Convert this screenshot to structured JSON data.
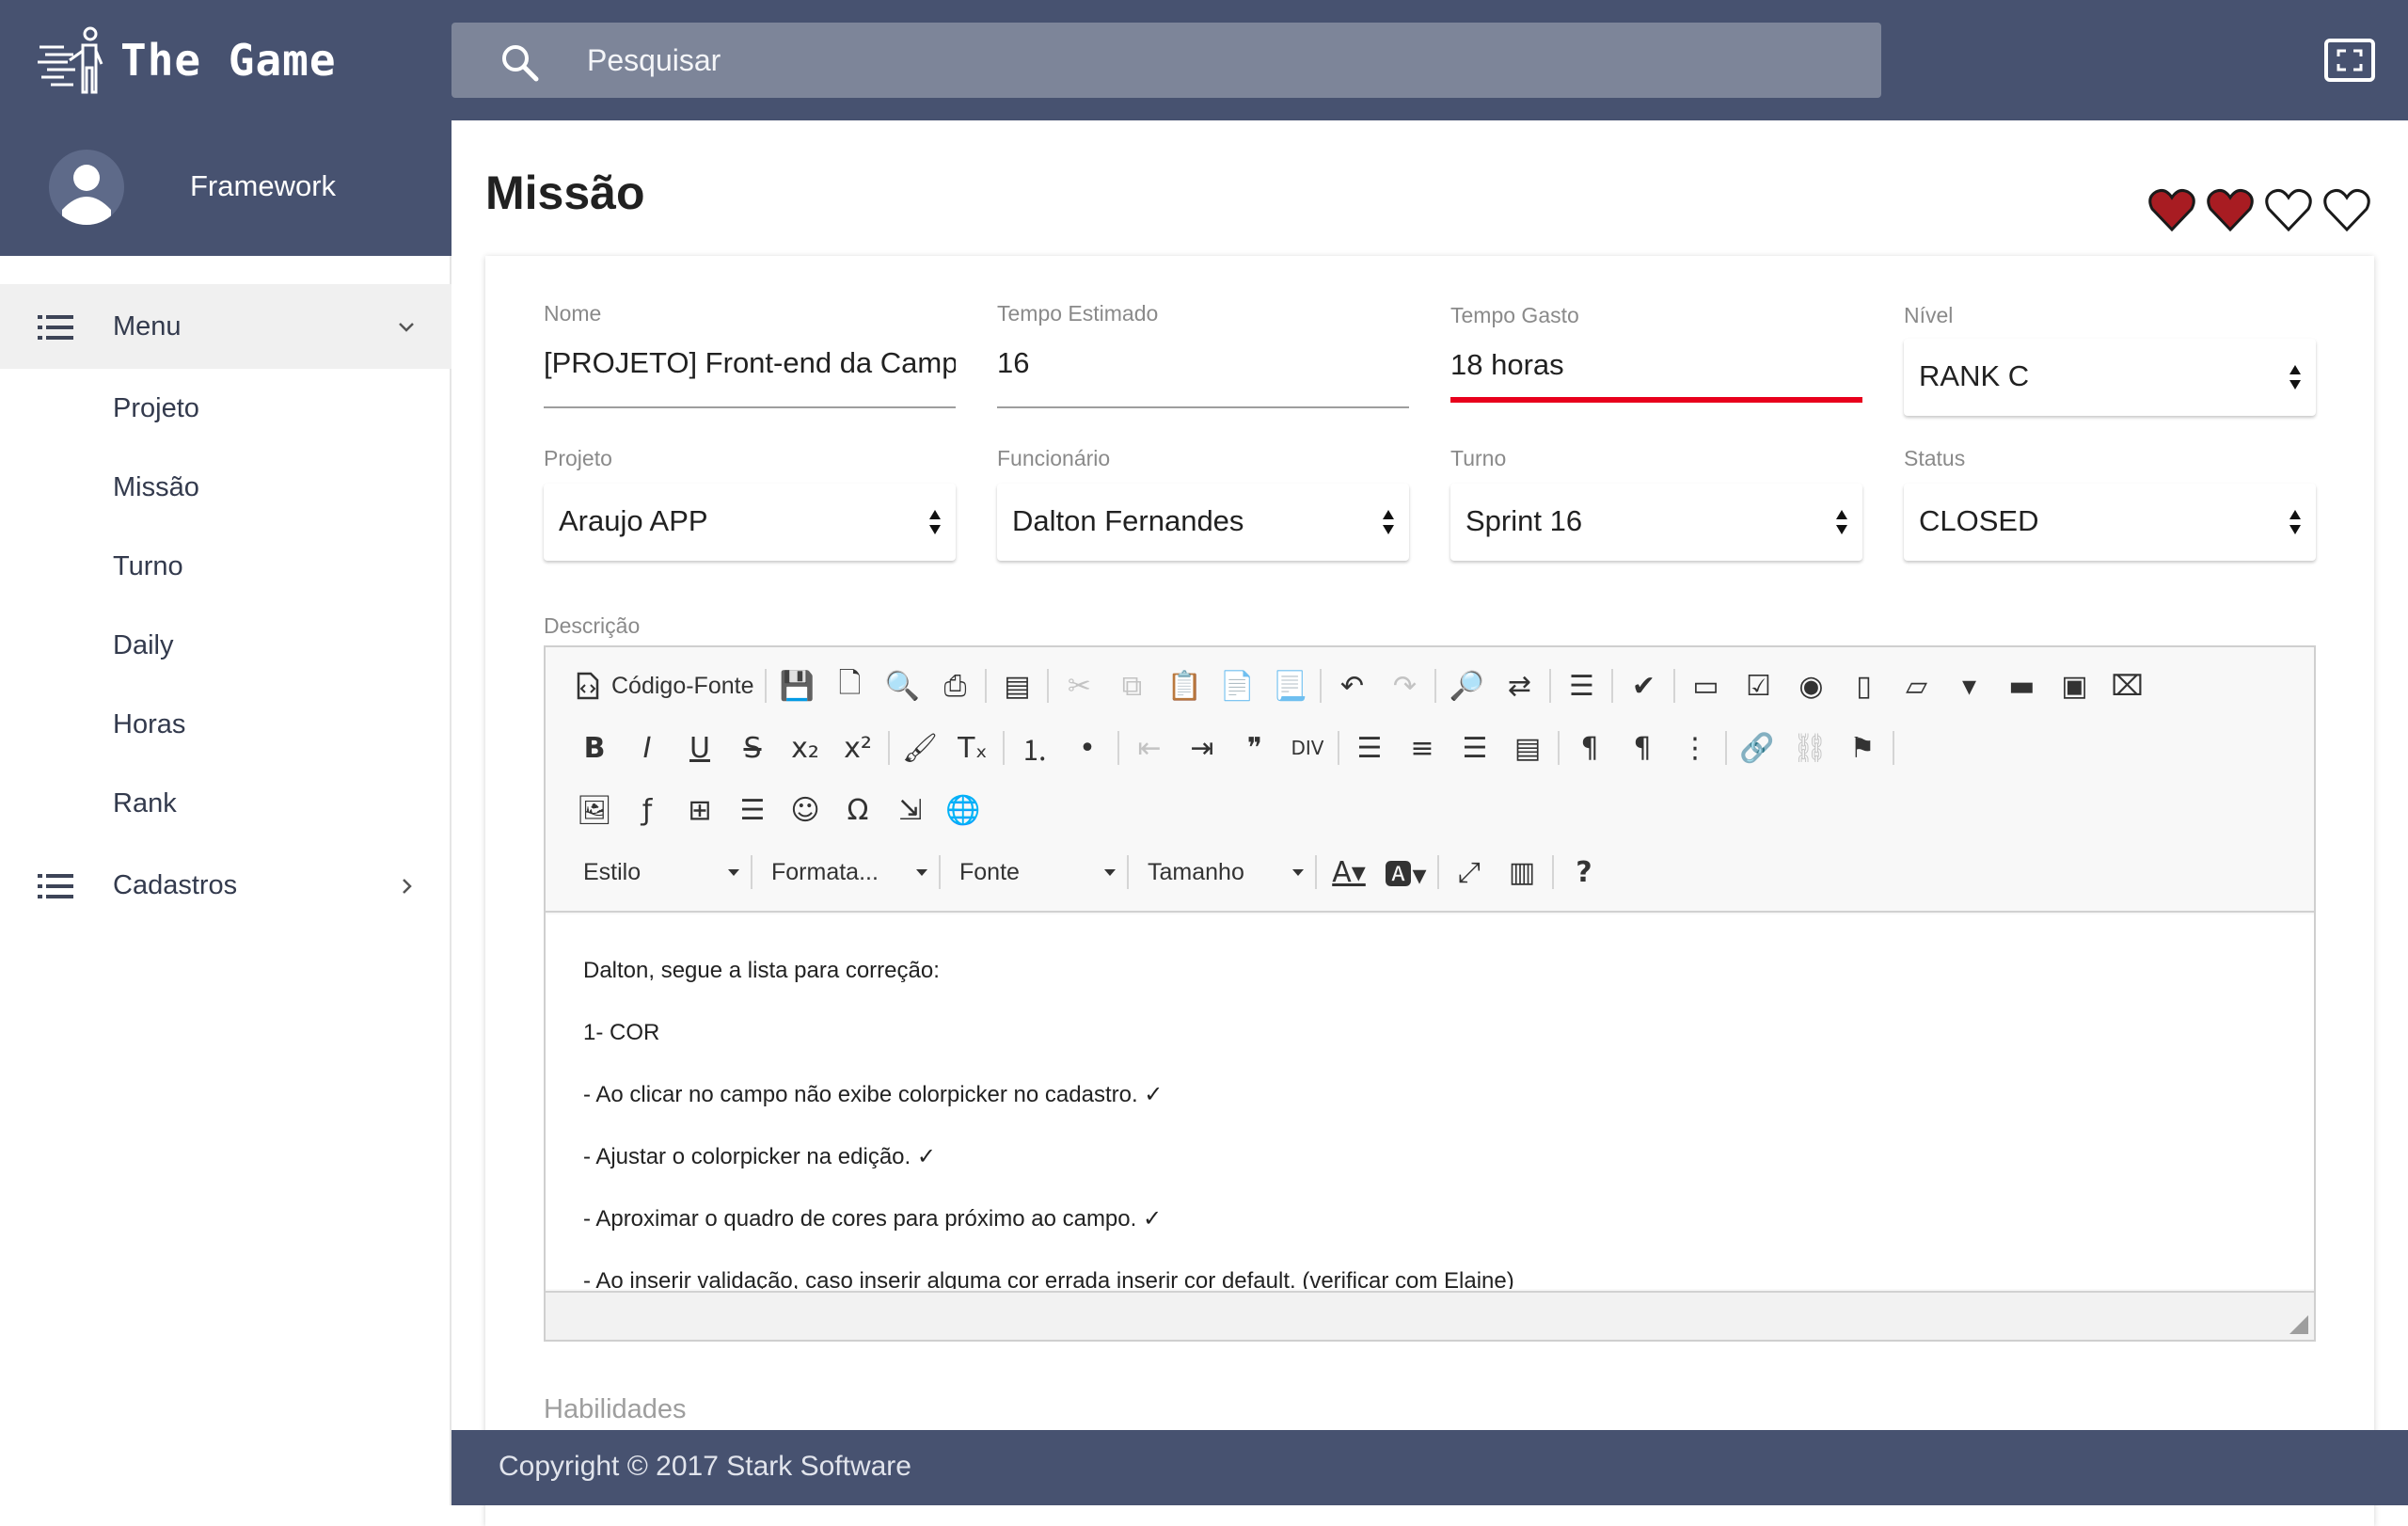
{
  "app": {
    "name": "The Game",
    "search_placeholder": "Pesquisar"
  },
  "profile": {
    "name": "Framework"
  },
  "sidebar": {
    "menu_label": "Menu",
    "items": [
      {
        "label": "Projeto"
      },
      {
        "label": "Missão"
      },
      {
        "label": "Turno"
      },
      {
        "label": "Daily"
      },
      {
        "label": "Horas"
      },
      {
        "label": "Rank"
      }
    ],
    "cadastros_label": "Cadastros"
  },
  "page": {
    "title": "Missão",
    "hearts": {
      "filled": 2,
      "total": 4,
      "color": "#a81c22"
    }
  },
  "form": {
    "nome": {
      "label": "Nome",
      "value": "[PROJETO] Front-end da Campanha"
    },
    "tempo_estimado": {
      "label": "Tempo Estimado",
      "value": "16"
    },
    "tempo_gasto": {
      "label": "Tempo Gasto",
      "value": "18 horas"
    },
    "nivel": {
      "label": "Nível",
      "value": "RANK C"
    },
    "projeto": {
      "label": "Projeto",
      "value": "Araujo APP"
    },
    "funcionario": {
      "label": "Funcionário",
      "value": "Dalton Fernandes"
    },
    "turno": {
      "label": "Turno",
      "value": "Sprint 16"
    },
    "status": {
      "label": "Status",
      "value": "CLOSED"
    },
    "descricao_label": "Descrição",
    "habilidades_label": "Habilidades"
  },
  "editor": {
    "source_button": "Código-Fonte",
    "combos": {
      "estilo": "Estilo",
      "formatacao": "Formata...",
      "fonte": "Fonte",
      "tamanho": "Tamanho"
    },
    "content": [
      "Dalton, segue a lista para correção:",
      " 1- COR",
      "- Ao clicar no campo não exibe colorpicker no cadastro. ✓",
      "- Ajustar o colorpicker na edição. ✓",
      "- Aproximar o quadro de cores para próximo ao campo. ✓",
      "- Ao inserir validação, caso inserir alguma cor errada inserir cor default. (verificar com Elaine)"
    ]
  },
  "footer": {
    "text": "Copyright © 2017 Stark Software"
  },
  "colors": {
    "header_bg": "#475270",
    "error_underline": "#e8001c"
  }
}
